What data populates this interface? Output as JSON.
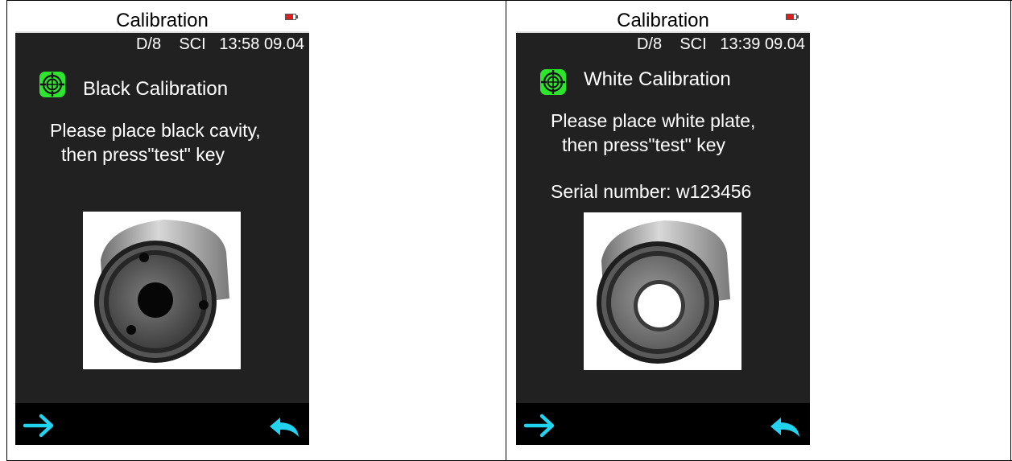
{
  "colors": {
    "screen_bg": "#212121",
    "bottom_bar": "#000000",
    "accent_cyan": "#22d3f0",
    "icon_green": "#2ee52e",
    "battery_red": "#e01e1e"
  },
  "icons": {
    "calibration": "calibration-target-icon",
    "next": "arrow-right-icon",
    "back": "return-arrow-icon",
    "battery": "battery-low-icon"
  },
  "screens": [
    {
      "title": "Calibration",
      "status": "D/8    SCI   13:58 09.04",
      "calibration_label": "Black Calibration",
      "instructions": [
        "Please place black cavity,",
        "then press\"test\" key"
      ],
      "serial": null,
      "photo": "black-cavity-image"
    },
    {
      "title": "Calibration",
      "status": "D/8    SCI   13:39 09.04",
      "calibration_label": "White Calibration",
      "instructions": [
        "Please place white plate,",
        "then press\"test\" key"
      ],
      "serial": "Serial number: w123456",
      "photo": "white-plate-image"
    }
  ]
}
